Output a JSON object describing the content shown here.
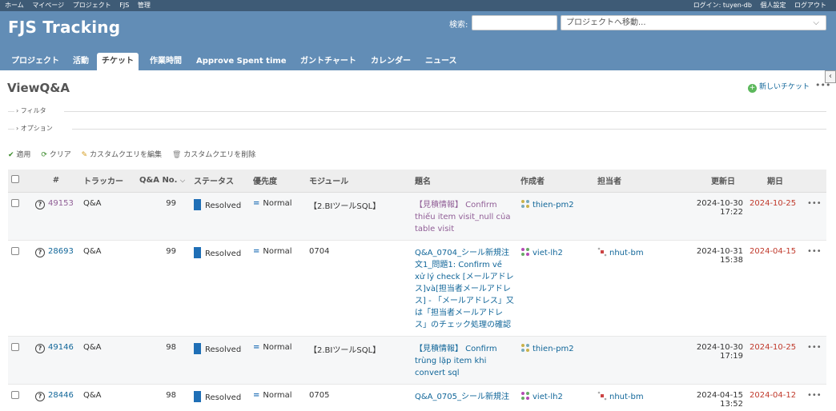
{
  "topbar": {
    "left": [
      "ホーム",
      "マイページ",
      "プロジェクト",
      "FJS",
      "管理"
    ],
    "logged_in": "ログイン: tuyen-db",
    "personal": "個人設定",
    "logout": "ログアウト"
  },
  "header": {
    "title": "FJS Tracking",
    "search_label": "検索:",
    "search_value": "",
    "project_jump": "プロジェクトへ移動..."
  },
  "tabs": [
    "プロジェクト",
    "活動",
    "チケット",
    "作業時間",
    "Approve Spent time",
    "ガントチャート",
    "カレンダー",
    "ニュース"
  ],
  "active_tab": "チケット",
  "page": {
    "title": "ViewQ&A",
    "new_issue": "新しいチケット",
    "filter_label": "フィルタ",
    "options_label": "オプション"
  },
  "query_actions": {
    "apply": "適用",
    "clear": "クリア",
    "edit": "カスタムクエリを編集",
    "delete": "カスタムクエリを削除"
  },
  "columns": {
    "id": "#",
    "tracker": "トラッカー",
    "qa_no": "Q&A No.",
    "status": "ステータス",
    "priority": "優先度",
    "module": "モジュール",
    "subject": "題名",
    "author": "作成者",
    "assignee": "担当者",
    "updated": "更新日",
    "due": "期日"
  },
  "rows": [
    {
      "id": "49153",
      "tracker": "Q&A",
      "qa_no": "99",
      "status": "Resolved",
      "priority": "Normal",
      "module": "【2.BIツールSQL】",
      "subject": "【見積情報】 Confirm thiếu item visit_null của table visit",
      "author": "thien-pm2",
      "assignee": "",
      "updated": "2024-10-30 17:22",
      "due": "2024-10-25"
    },
    {
      "id": "28693",
      "tracker": "Q&A",
      "qa_no": "99",
      "status": "Resolved",
      "priority": "Normal",
      "module": "0704",
      "subject": "Q&A_0704_シール新規注文1_問題1: Confirm về xử lý check [メールアドレス]và[担当者メールアドレス] - 「メールアドレス」又は「担当者メールアドレス」のチェック処理の確認",
      "author": "viet-lh2",
      "assignee": "nhut-bm",
      "updated": "2024-10-31 15:38",
      "due": "2024-04-15"
    },
    {
      "id": "49146",
      "tracker": "Q&A",
      "qa_no": "98",
      "status": "Resolved",
      "priority": "Normal",
      "module": "【2.BIツールSQL】",
      "subject": "【見積情報】 Confirm trùng lặp item khi convert sql",
      "author": "thien-pm2",
      "assignee": "",
      "updated": "2024-10-30 17:19",
      "due": "2024-10-25"
    },
    {
      "id": "28446",
      "tracker": "Q&A",
      "qa_no": "98",
      "status": "Resolved",
      "priority": "Normal",
      "module": "0705",
      "subject": "Q&A_0705_シール新規注",
      "author": "viet-lh2",
      "assignee": "nhut-bm",
      "updated": "2024-04-15 13:52",
      "due": "2024-04-12"
    }
  ],
  "colors": {
    "header_bg": "#628db6",
    "topbar_bg": "#3e5b76",
    "link": "#116699",
    "visited_link": "#905e96",
    "status_resolved": "#1f6fb6",
    "due_overdue": "#c0392b"
  }
}
